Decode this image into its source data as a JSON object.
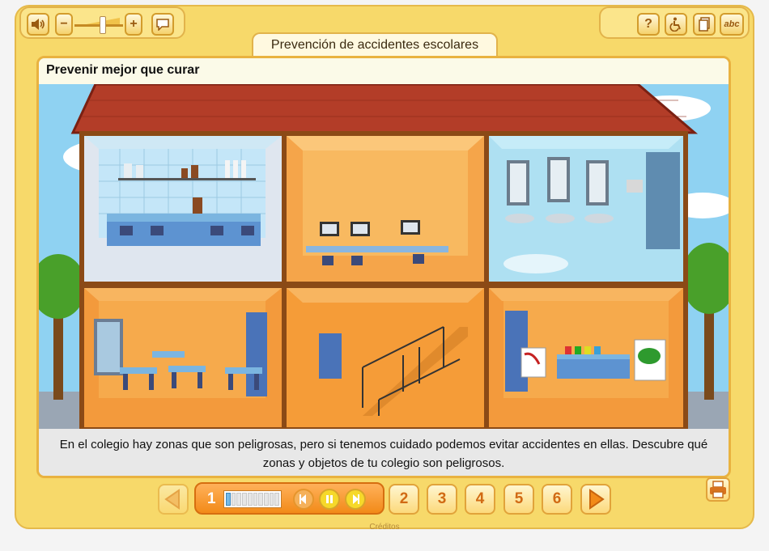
{
  "app": {
    "title": "Prevención de accidentes escolares",
    "credits_label": "Créditos"
  },
  "toolbar_left": {
    "sound_icon": "speaker-icon",
    "volume_minus": "−",
    "volume_plus": "+",
    "subtitles_icon": "speech-bubble-icon",
    "volume_level": 0.6
  },
  "toolbar_right": {
    "help_label": "?",
    "accessibility_icon": "wheelchair-icon",
    "page_icon": "document-icon",
    "text_label": "abc"
  },
  "main": {
    "heading": "Prevenir mejor que curar",
    "caption": "En el colegio hay zonas que son peligrosas, pero si tenemos cuidado podemos evitar accidentes en ellas. Descubre qué zonas y objetos de tu colegio son peligrosos.",
    "rooms": [
      "laboratory",
      "computer-room",
      "bathroom",
      "classroom",
      "stairs",
      "art-room"
    ]
  },
  "navigation": {
    "current_page": "1",
    "progress_segments": 10,
    "progress_filled": 1,
    "pages": [
      "2",
      "3",
      "4",
      "5",
      "6"
    ],
    "colors": {
      "accent": "#f28a18",
      "frame": "#f7d96a"
    }
  }
}
